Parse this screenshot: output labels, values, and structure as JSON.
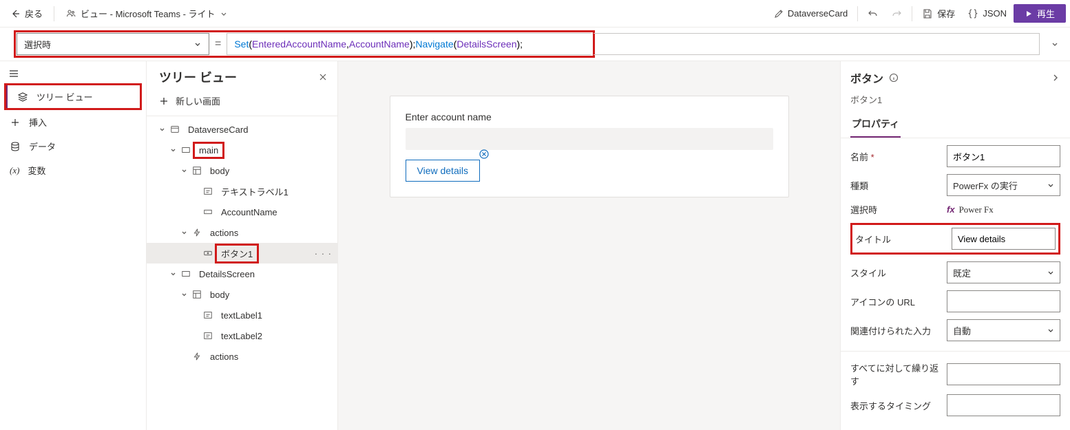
{
  "topbar": {
    "back": "戻る",
    "title": "ビュー - Microsoft Teams - ライト",
    "dataverse": "DataverseCard",
    "save": "保存",
    "json": "JSON",
    "play": "再生"
  },
  "formula": {
    "property": "選択時",
    "tokens": [
      {
        "t": "fn",
        "v": "Set"
      },
      {
        "t": "p",
        "v": "("
      },
      {
        "t": "id",
        "v": "EnteredAccountName"
      },
      {
        "t": "p",
        "v": ", "
      },
      {
        "t": "id",
        "v": "AccountName"
      },
      {
        "t": "p",
        "v": "); "
      },
      {
        "t": "fn",
        "v": "Navigate"
      },
      {
        "t": "p",
        "v": "("
      },
      {
        "t": "id",
        "v": "DetailsScreen"
      },
      {
        "t": "p",
        "v": ");"
      }
    ]
  },
  "rail": {
    "tree_view": "ツリー ビュー",
    "insert": "挿入",
    "data": "データ",
    "vars": "変数"
  },
  "tree": {
    "title": "ツリー ビュー",
    "new_screen": "新しい画面",
    "nodes": [
      {
        "indent": 0,
        "label": "DataverseCard",
        "icon": "card",
        "expand": true
      },
      {
        "indent": 1,
        "label": "main",
        "icon": "rect",
        "expand": true,
        "hl": true
      },
      {
        "indent": 2,
        "label": "body",
        "icon": "layout",
        "expand": true
      },
      {
        "indent": 3,
        "label": "テキストラベル1",
        "icon": "text"
      },
      {
        "indent": 3,
        "label": "AccountName",
        "icon": "input"
      },
      {
        "indent": 2,
        "label": "actions",
        "icon": "bolt",
        "expand": true
      },
      {
        "indent": 3,
        "label": "ボタン1",
        "icon": "button",
        "hl": true,
        "selected": true
      },
      {
        "indent": 1,
        "label": "DetailsScreen",
        "icon": "rect",
        "expand": true
      },
      {
        "indent": 2,
        "label": "body",
        "icon": "layout",
        "expand": true
      },
      {
        "indent": 3,
        "label": "textLabel1",
        "icon": "text"
      },
      {
        "indent": 3,
        "label": "textLabel2",
        "icon": "text"
      },
      {
        "indent": 2,
        "label": "actions",
        "icon": "bolt"
      }
    ]
  },
  "canvas": {
    "label": "Enter account name",
    "button": "View details"
  },
  "props": {
    "title": "ボタン",
    "subtitle": "ボタン1",
    "tab": "プロパティ",
    "rows": {
      "name_lbl": "名前",
      "name_val": "ボタン1",
      "type_lbl": "種類",
      "type_val": "PowerFx の実行",
      "onselect_lbl": "選択時",
      "onselect_val": "Power Fx",
      "onselect_prefix": "fx",
      "title_lbl": "タイトル",
      "title_val": "View details",
      "style_lbl": "スタイル",
      "style_val": "既定",
      "iconurl_lbl": "アイコンの URL",
      "assoc_lbl": "関連付けられた入力",
      "assoc_val": "自動",
      "repeat_lbl": "すべてに対して繰り返す",
      "vis_lbl": "表示するタイミング"
    }
  }
}
